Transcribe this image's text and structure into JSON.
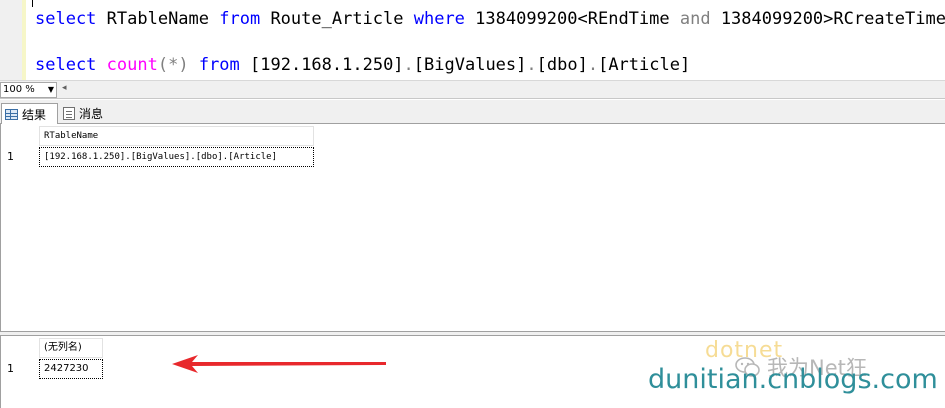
{
  "editor": {
    "line1": {
      "t1": "select",
      "t2": " RTableName ",
      "t3": "from",
      "t4": " Route_Article ",
      "t5": "where",
      "t6": " 1384099200<REndTime ",
      "t7": "and",
      "t8": " 1384099200>RCreateTime"
    },
    "line2": {
      "t1": "select",
      "t2": " ",
      "t3": "count",
      "t4": "(*)",
      "t5": " ",
      "t6": "from",
      "t7": " [192.168.1.250]",
      "t8": ".",
      "t9": "[BigValues]",
      "t10": ".",
      "t11": "[dbo]",
      "t12": ".",
      "t13": "[Article]"
    }
  },
  "zoom": {
    "value": "100 %"
  },
  "tabs": {
    "results": "结果",
    "messages": "消息"
  },
  "grid1": {
    "columns": [
      "RTableName"
    ],
    "rows": [
      {
        "num": "1",
        "values": [
          "[192.168.1.250].[BigValues].[dbo].[Article]"
        ]
      }
    ]
  },
  "grid2": {
    "columns": [
      "(无列名)"
    ],
    "rows": [
      {
        "num": "1",
        "values": [
          "2427230"
        ]
      }
    ]
  },
  "watermark": {
    "top": "dotnet",
    "middle": "我为Net狂",
    "bottom": "dunitian.cnblogs.com"
  },
  "colors": {
    "keyword": "#0000ff",
    "function": "#ff00ff",
    "operator": "#808080",
    "arrow": "#e8282c",
    "watermark": "#2f8f9a"
  },
  "icons": [
    "grid-icon",
    "message-icon",
    "wechat-icon",
    "arrow-left-icon",
    "dropdown-arrow-icon"
  ]
}
